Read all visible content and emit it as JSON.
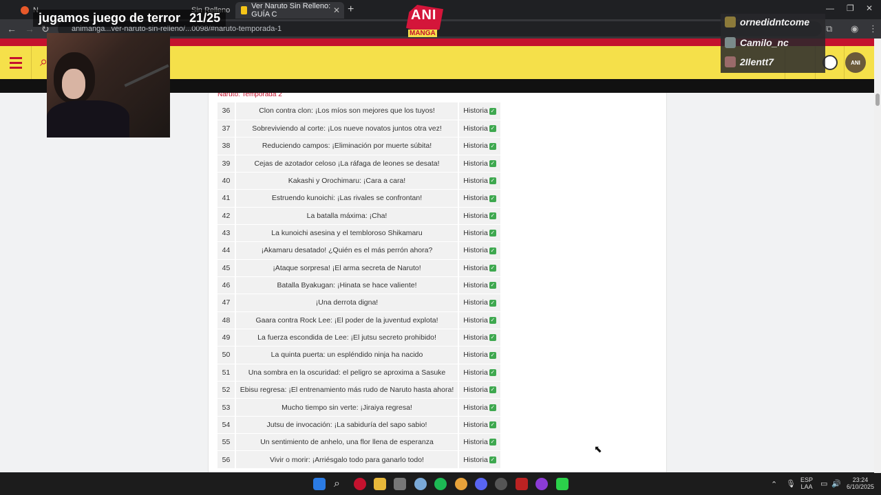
{
  "browser": {
    "tabs": [
      {
        "label": "N"
      },
      {
        "label": "Sin Relleno"
      },
      {
        "label": "Ver Naruto Sin Relleno: GUÍA C"
      }
    ],
    "new_tab": "+",
    "address": "animanga...ver-naruto-sin-relleno/...0098/#naruto-temporada-1"
  },
  "stream": {
    "title": "jugamos juego de terror",
    "counter": "21/25",
    "chat": [
      {
        "name": "ornedidntcome"
      },
      {
        "name": "Camilo_nc"
      },
      {
        "name": "2Ilentt7"
      }
    ]
  },
  "site": {
    "logo_top": "ANI",
    "logo_bottom": "MANGA",
    "avatar_text": "ANI",
    "section_title": "Naruto: Temporada 2"
  },
  "episodes": [
    {
      "num": "36",
      "title": "Clon contra clon: ¡Los míos son mejores que los tuyos!",
      "type": "Historia"
    },
    {
      "num": "37",
      "title": "Sobreviviendo al corte: ¡Los nueve novatos juntos otra vez!",
      "type": "Historia"
    },
    {
      "num": "38",
      "title": "Reduciendo campos: ¡Eliminación por muerte súbita!",
      "type": "Historia"
    },
    {
      "num": "39",
      "title": "Cejas de azotador celoso ¡La ráfaga de leones se desata!",
      "type": "Historia"
    },
    {
      "num": "40",
      "title": "Kakashi y Orochimaru: ¡Cara a cara!",
      "type": "Historia"
    },
    {
      "num": "41",
      "title": "Estruendo kunoichi: ¡Las rivales se confrontan!",
      "type": "Historia"
    },
    {
      "num": "42",
      "title": "La batalla máxima: ¡Cha!",
      "type": "Historia"
    },
    {
      "num": "43",
      "title": "La kunoichi asesina y el tembloroso Shikamaru",
      "type": "Historia"
    },
    {
      "num": "44",
      "title": "¡Akamaru desatado! ¿Quién es el más perrón ahora?",
      "type": "Historia"
    },
    {
      "num": "45",
      "title": "¡Ataque sorpresa! ¡El arma secreta de Naruto!",
      "type": "Historia"
    },
    {
      "num": "46",
      "title": "Batalla Byakugan: ¡Hinata se hace valiente!",
      "type": "Historia"
    },
    {
      "num": "47",
      "title": "¡Una derrota digna!",
      "type": "Historia"
    },
    {
      "num": "48",
      "title": "Gaara contra Rock Lee: ¡El poder de la juventud explota!",
      "type": "Historia"
    },
    {
      "num": "49",
      "title": "La fuerza escondida de Lee: ¡El jutsu secreto prohibido!",
      "type": "Historia"
    },
    {
      "num": "50",
      "title": "La quinta puerta: un espléndido ninja ha nacido",
      "type": "Historia"
    },
    {
      "num": "51",
      "title": "Una sombra en la oscuridad: el peligro se aproxima a Sasuke",
      "type": "Historia"
    },
    {
      "num": "52",
      "title": "Ebisu regresa: ¡El entrenamiento más rudo de Naruto hasta ahora!",
      "type": "Historia"
    },
    {
      "num": "53",
      "title": "Mucho tiempo sin verte: ¡Jiraiya regresa!",
      "type": "Historia"
    },
    {
      "num": "54",
      "title": "Jutsu de invocación: ¡La sabiduría del sapo sabio!",
      "type": "Historia"
    },
    {
      "num": "55",
      "title": "Un sentimiento de anhelo, una flor llena de esperanza",
      "type": "Historia"
    },
    {
      "num": "56",
      "title": "Vivir o morir: ¡Arriésgalo todo para ganarlo todo!",
      "type": "Historia"
    }
  ],
  "check_glyph": "✓",
  "colors": {
    "brand_red": "#c4122e",
    "brand_yellow": "#f5e04a",
    "check_green": "#3ea84f"
  },
  "taskbar": {
    "lang_top": "ESP",
    "lang_bottom": "LAA",
    "time": "23:24",
    "date": "6/10/2025"
  }
}
